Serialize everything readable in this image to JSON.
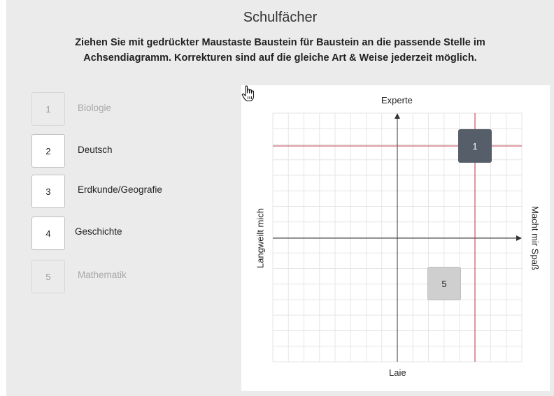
{
  "title": "Schulfächer",
  "instructions": "Ziehen Sie mit gedrückter Maustaste Baustein für Baustein an die passende Stelle im Achsendiagramm. Korrekturen sind auf die gleiche Art & Weise jederzeit möglich.",
  "items": [
    {
      "number": "1",
      "label": "Biologie",
      "placed": true
    },
    {
      "number": "2",
      "label": "Deutsch",
      "placed": false
    },
    {
      "number": "3",
      "label": "Erdkunde/Geografie",
      "placed": false
    },
    {
      "number": "4",
      "label": "Geschichte",
      "placed": false
    },
    {
      "number": "5",
      "label": "Mathematik",
      "placed": true
    }
  ],
  "diagram": {
    "axis_top": "Experte",
    "axis_bottom": "Laie",
    "axis_left": "Langweilt mich",
    "axis_right": "Macht mir Spaß",
    "placed_chips": [
      {
        "number": "1",
        "state": "dragging"
      },
      {
        "number": "5",
        "state": "placed"
      }
    ]
  },
  "colors": {
    "background": "#ebebeb",
    "chip_active": "#555e69",
    "chip_placed": "#cfcfcf",
    "guide_lines": "#c0394b",
    "grid": "#e6e6e6"
  }
}
